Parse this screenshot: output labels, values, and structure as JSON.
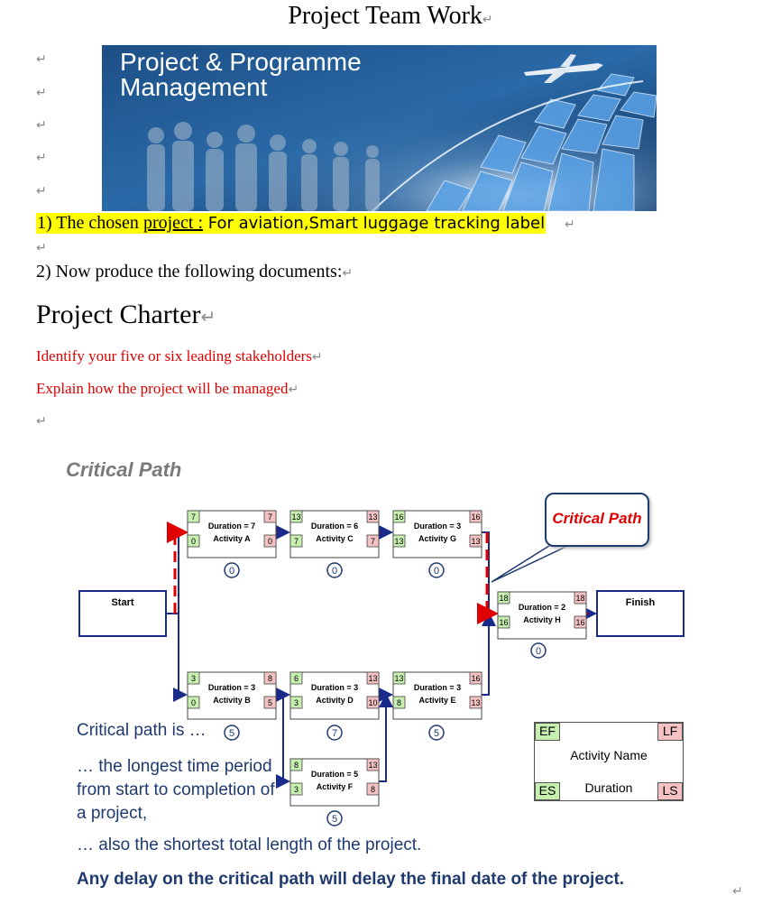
{
  "document": {
    "title": "Project Team Work",
    "paragraph_mark": "↵",
    "banner": {
      "line1": "Project & Programme",
      "line2": "Management"
    },
    "chosen_project": {
      "prefix": "1) The chosen ",
      "link": "project :",
      "value": " For aviation,Smart luggage tracking label"
    },
    "produce_line": "2) Now produce the following documents:",
    "charter_heading": "Project Charter",
    "red_lines": [
      "Identify your five or six leading stakeholders",
      "Explain how the project will be managed"
    ]
  },
  "critical_path_slide": {
    "title": "Critical Path",
    "callout": "Critical Path",
    "start_label": "Start",
    "finish_label": "Finish",
    "activities": [
      {
        "name": "Activity A",
        "duration": "Duration = 7",
        "es": "0",
        "ef": "7",
        "ls": "0",
        "lf": "7",
        "slack": "0"
      },
      {
        "name": "Activity C",
        "duration": "Duration = 6",
        "es": "7",
        "ef": "13",
        "ls": "7",
        "lf": "13",
        "slack": "0"
      },
      {
        "name": "Activity G",
        "duration": "Duration = 3",
        "es": "13",
        "ef": "16",
        "ls": "13",
        "lf": "16",
        "slack": "0"
      },
      {
        "name": "Activity H",
        "duration": "Duration = 2",
        "es": "16",
        "ef": "18",
        "ls": "16",
        "lf": "18",
        "slack": "0"
      },
      {
        "name": "Activity B",
        "duration": "Duration = 3",
        "es": "0",
        "ef": "3",
        "ls": "5",
        "lf": "8",
        "slack": "5"
      },
      {
        "name": "Activity D",
        "duration": "Duration = 3",
        "es": "3",
        "ef": "6",
        "ls": "10",
        "lf": "13",
        "slack": "7"
      },
      {
        "name": "Activity E",
        "duration": "Duration = 3",
        "es": "8",
        "ef": "13",
        "ls": "13",
        "lf": "16",
        "slack": "5"
      },
      {
        "name": "Activity F",
        "duration": "Duration = 5",
        "es": "3",
        "ef": "8",
        "ls": "8",
        "lf": "13",
        "slack": "5"
      }
    ],
    "legend": {
      "ef": "EF",
      "lf": "LF",
      "es": "ES",
      "ls": "LS",
      "name": "Activity Name",
      "duration": "Duration"
    },
    "text": {
      "cp_is": "Critical path is …",
      "longest": "… the longest time period from start to completion of a project,",
      "shortest": "… also the shortest total length of the project.",
      "delay": "Any delay on the critical path will delay the final date of the project."
    },
    "colors": {
      "critical": "#e00000",
      "arrow": "#1a2a8a",
      "green": "#c6efb0",
      "pink": "#f4c2c2",
      "callout_text": "#e00000"
    }
  }
}
